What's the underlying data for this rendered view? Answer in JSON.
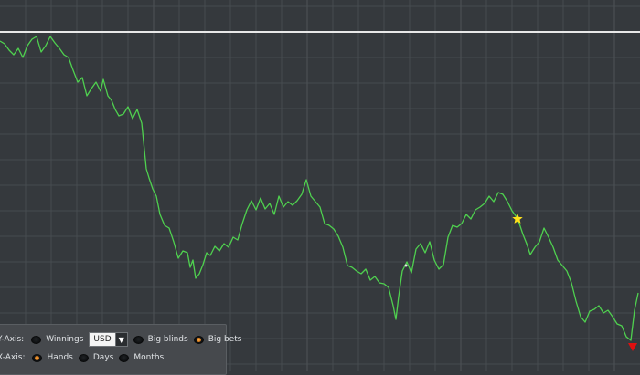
{
  "chart_data": {
    "type": "line",
    "title": "",
    "xlabel": "",
    "ylabel": "",
    "grid": true,
    "x_range": [
      0,
      700
    ],
    "y_range": [
      -320,
      0
    ],
    "reference_line": {
      "y": 0,
      "color": "#e8e8e8"
    },
    "series": [
      {
        "color": "#4fd04f",
        "points": [
          [
            0,
            -10
          ],
          [
            5,
            -13
          ],
          [
            10,
            -20
          ],
          [
            15,
            -25
          ],
          [
            20,
            -18
          ],
          [
            25,
            -28
          ],
          [
            30,
            -15
          ],
          [
            35,
            -8
          ],
          [
            40,
            -5
          ],
          [
            45,
            -22
          ],
          [
            50,
            -15
          ],
          [
            55,
            -5
          ],
          [
            60,
            -12
          ],
          [
            65,
            -18
          ],
          [
            70,
            -25
          ],
          [
            75,
            -28
          ],
          [
            80,
            -42
          ],
          [
            85,
            -55
          ],
          [
            90,
            -50
          ],
          [
            95,
            -70
          ],
          [
            100,
            -62
          ],
          [
            105,
            -55
          ],
          [
            110,
            -65
          ],
          [
            113,
            -52
          ],
          [
            118,
            -70
          ],
          [
            122,
            -75
          ],
          [
            126,
            -85
          ],
          [
            130,
            -92
          ],
          [
            135,
            -90
          ],
          [
            140,
            -82
          ],
          [
            145,
            -95
          ],
          [
            150,
            -85
          ],
          [
            155,
            -100
          ],
          [
            158,
            -130
          ],
          [
            160,
            -150
          ],
          [
            163,
            -160
          ],
          [
            167,
            -172
          ],
          [
            171,
            -180
          ],
          [
            175,
            -200
          ],
          [
            180,
            -212
          ],
          [
            185,
            -215
          ],
          [
            190,
            -230
          ],
          [
            195,
            -248
          ],
          [
            200,
            -240
          ],
          [
            205,
            -242
          ],
          [
            208,
            -258
          ],
          [
            211,
            -250
          ],
          [
            214,
            -270
          ],
          [
            218,
            -265
          ],
          [
            222,
            -255
          ],
          [
            226,
            -242
          ],
          [
            230,
            -245
          ],
          [
            235,
            -235
          ],
          [
            240,
            -240
          ],
          [
            245,
            -232
          ],
          [
            250,
            -236
          ],
          [
            255,
            -225
          ],
          [
            260,
            -228
          ],
          [
            265,
            -210
          ],
          [
            270,
            -195
          ],
          [
            275,
            -185
          ],
          [
            280,
            -195
          ],
          [
            285,
            -182
          ],
          [
            290,
            -194
          ],
          [
            295,
            -188
          ],
          [
            300,
            -200
          ],
          [
            305,
            -180
          ],
          [
            310,
            -192
          ],
          [
            315,
            -186
          ],
          [
            320,
            -190
          ],
          [
            325,
            -185
          ],
          [
            330,
            -178
          ],
          [
            335,
            -162
          ],
          [
            340,
            -180
          ],
          [
            345,
            -186
          ],
          [
            350,
            -192
          ],
          [
            355,
            -210
          ],
          [
            360,
            -212
          ],
          [
            365,
            -216
          ],
          [
            370,
            -224
          ],
          [
            375,
            -236
          ],
          [
            380,
            -256
          ],
          [
            385,
            -258
          ],
          [
            390,
            -262
          ],
          [
            395,
            -265
          ],
          [
            400,
            -260
          ],
          [
            405,
            -272
          ],
          [
            410,
            -268
          ],
          [
            415,
            -275
          ],
          [
            420,
            -276
          ],
          [
            425,
            -280
          ],
          [
            430,
            -300
          ],
          [
            433,
            -315
          ],
          [
            436,
            -290
          ],
          [
            440,
            -262
          ],
          [
            445,
            -252
          ],
          [
            450,
            -264
          ],
          [
            455,
            -238
          ],
          [
            460,
            -232
          ],
          [
            465,
            -242
          ],
          [
            470,
            -230
          ],
          [
            475,
            -250
          ],
          [
            480,
            -260
          ],
          [
            485,
            -255
          ],
          [
            490,
            -225
          ],
          [
            495,
            -212
          ],
          [
            500,
            -214
          ],
          [
            505,
            -210
          ],
          [
            510,
            -200
          ],
          [
            515,
            -205
          ],
          [
            520,
            -195
          ],
          [
            525,
            -192
          ],
          [
            530,
            -188
          ],
          [
            535,
            -180
          ],
          [
            540,
            -186
          ],
          [
            545,
            -176
          ],
          [
            550,
            -178
          ],
          [
            555,
            -186
          ],
          [
            560,
            -196
          ],
          [
            565,
            -203
          ],
          [
            568,
            -210
          ],
          [
            572,
            -222
          ],
          [
            576,
            -232
          ],
          [
            580,
            -244
          ],
          [
            585,
            -236
          ],
          [
            590,
            -230
          ],
          [
            595,
            -215
          ],
          [
            600,
            -225
          ],
          [
            605,
            -236
          ],
          [
            610,
            -250
          ],
          [
            615,
            -256
          ],
          [
            620,
            -262
          ],
          [
            625,
            -275
          ],
          [
            630,
            -295
          ],
          [
            635,
            -312
          ],
          [
            640,
            -318
          ],
          [
            645,
            -306
          ],
          [
            650,
            -304
          ],
          [
            655,
            -300
          ],
          [
            660,
            -308
          ],
          [
            665,
            -305
          ],
          [
            670,
            -312
          ],
          [
            675,
            -320
          ],
          [
            680,
            -322
          ],
          [
            685,
            -334
          ],
          [
            690,
            -338
          ],
          [
            694,
            -305
          ],
          [
            698,
            -286
          ]
        ]
      }
    ],
    "markers": [
      {
        "type": "star",
        "x": 566,
        "y": -205,
        "color": "#ffe11a"
      },
      {
        "type": "triangle-down",
        "x": 692,
        "y": -345,
        "color": "#e01010"
      },
      {
        "type": "dot",
        "x": 444,
        "y": -256,
        "color": "#e8e8e8"
      }
    ]
  },
  "controls": {
    "y_axis_label": "Y-Axis:",
    "y_options": [
      "Winnings",
      "Big blinds",
      "Big bets"
    ],
    "y_selected": "Big bets",
    "currency": "USD",
    "x_axis_label": "X-Axis:",
    "x_options": [
      "Hands",
      "Days",
      "Months"
    ],
    "x_selected": "Hands"
  },
  "colors": {
    "background": "#35393d",
    "grid": "#4b5054",
    "line": "#4fd04f"
  }
}
